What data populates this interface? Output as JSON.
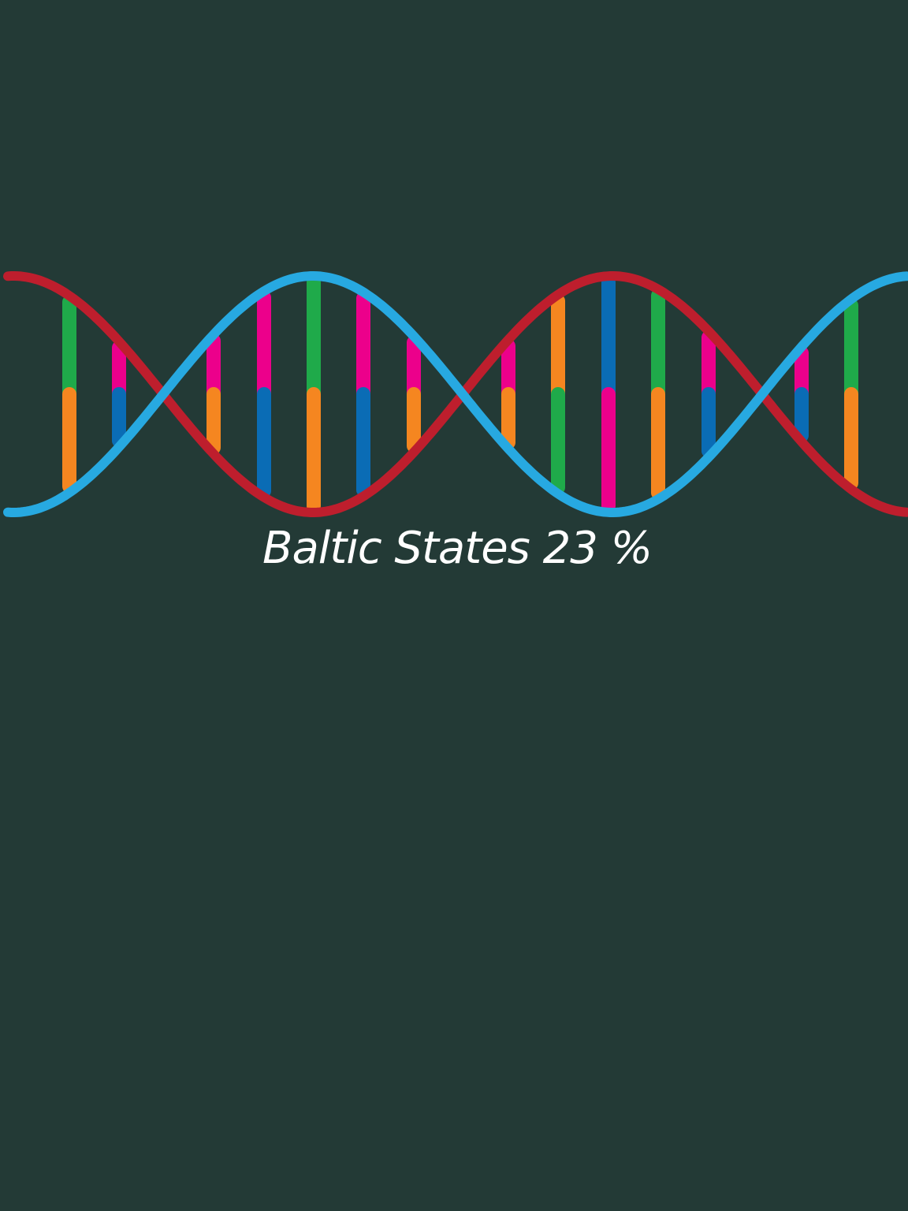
{
  "caption": {
    "label": "Baltic States",
    "value": "23",
    "unit": "%"
  },
  "colors": {
    "background": "#233a36",
    "strand_red": "#be1e2d",
    "strand_blue": "#27a9e1",
    "base_green": "#1faa4a",
    "base_orange": "#f58620",
    "base_magenta": "#ec008b",
    "base_blue": "#0a6cb5",
    "caption_text": "#ffffff"
  },
  "dna": {
    "rungs": [
      {
        "top": "green",
        "bottom": "orange"
      },
      {
        "top": "magenta",
        "bottom": "blue"
      },
      {
        "top": "magenta",
        "bottom": "orange"
      },
      {
        "top": "magenta",
        "bottom": "blue"
      },
      {
        "top": "green",
        "bottom": "orange"
      },
      {
        "top": "magenta",
        "bottom": "blue"
      },
      {
        "top": "magenta",
        "bottom": "orange"
      },
      {
        "top": "magenta",
        "bottom": "orange"
      },
      {
        "top": "orange",
        "bottom": "green"
      },
      {
        "top": "blue",
        "bottom": "magenta"
      },
      {
        "top": "green",
        "bottom": "orange"
      },
      {
        "top": "magenta",
        "bottom": "blue"
      },
      {
        "top": "magenta",
        "bottom": "blue"
      },
      {
        "top": "green",
        "bottom": "orange"
      }
    ]
  }
}
